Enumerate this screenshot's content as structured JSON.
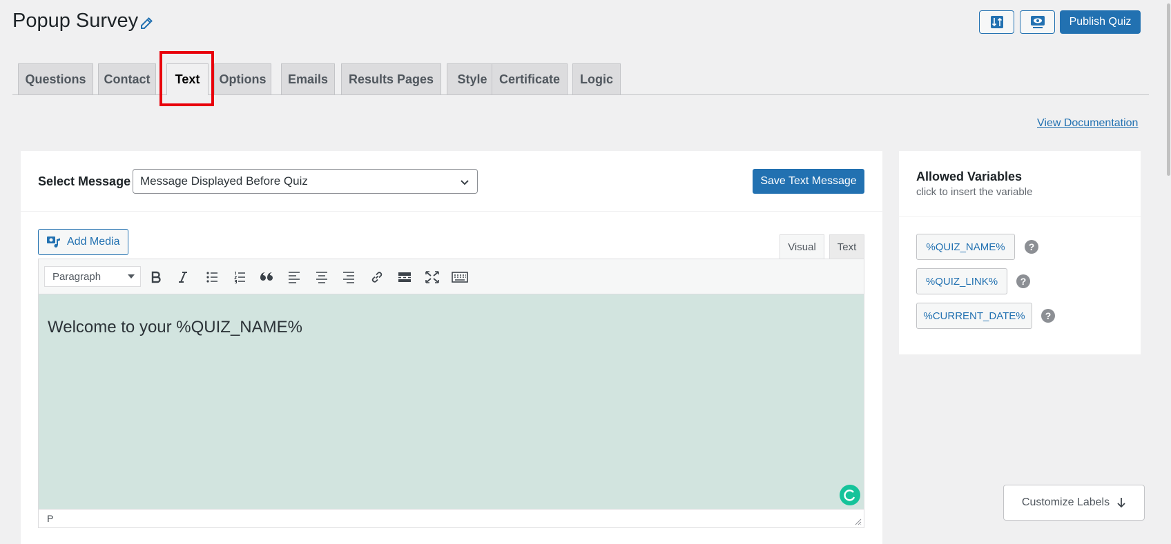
{
  "header": {
    "title": "Popup Survey",
    "publish_label": "Publish Quiz"
  },
  "tabs": [
    {
      "label": "Questions"
    },
    {
      "label": "Contact"
    },
    {
      "label": "Text"
    },
    {
      "label": "Options"
    },
    {
      "label": "Emails"
    },
    {
      "label": "Results Pages"
    },
    {
      "label": "Style"
    },
    {
      "label": "Certificate"
    },
    {
      "label": "Logic"
    }
  ],
  "active_tab": "Text",
  "view_documentation": "View Documentation",
  "message": {
    "label": "Select Message",
    "selected": "Message Displayed Before Quiz",
    "save_label": "Save Text Message"
  },
  "editor": {
    "add_media": "Add Media",
    "tab_visual": "Visual",
    "tab_text": "Text",
    "format": "Paragraph",
    "content": "Welcome to your %QUIZ_NAME%",
    "status_path": "P",
    "background": "#d2e4df"
  },
  "variables": {
    "title": "Allowed Variables",
    "subtitle": "click to insert the variable",
    "items": [
      "%QUIZ_NAME%",
      "%QUIZ_LINK%",
      "%CURRENT_DATE%"
    ],
    "help_glyph": "?"
  },
  "customize_labels": "Customize Labels",
  "colors": {
    "accent": "#2271b1",
    "highlight": "#e8000b"
  }
}
